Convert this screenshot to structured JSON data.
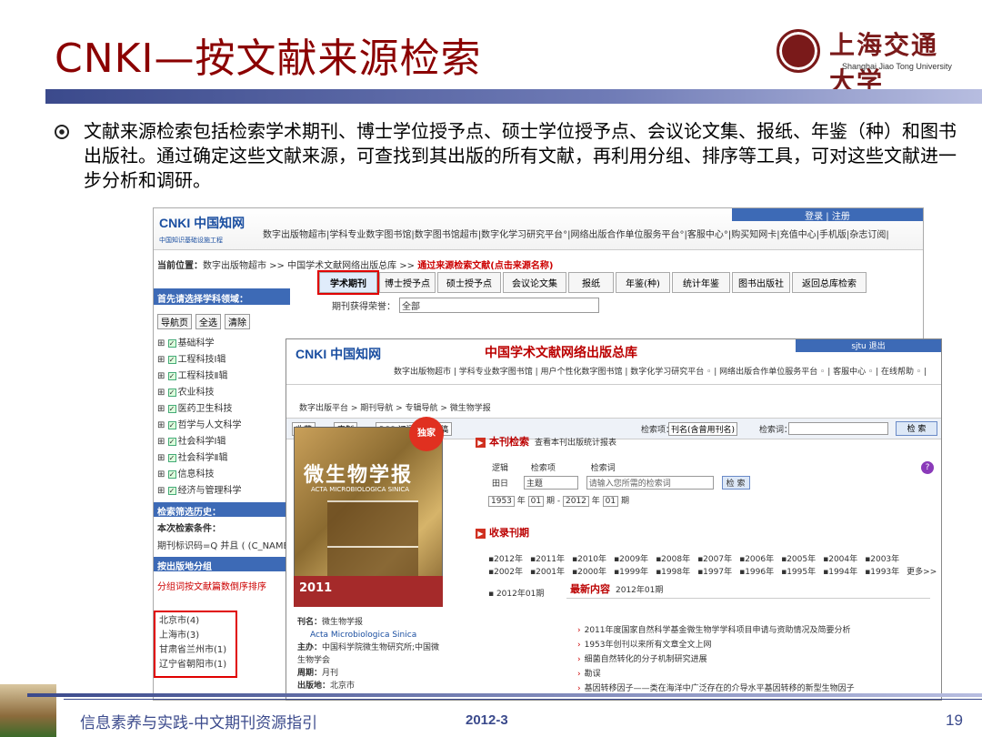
{
  "slide": {
    "title": "CNKI—按文献来源检索",
    "logo_cn": "上海交通大学",
    "logo_en": "Shanghai Jiao Tong University",
    "bullet": "文献来源检索包括检索学术期刊、博士学位授予点、硕士学位授予点、会议论文集、报纸、年鉴（种）和图书出版社。通过确定这些文献来源，可查找到其出版的所有文献，再利用分组、排序等工具，可对这些文献进一步分析和调研。",
    "footer_left": "信息素养与实践-中文期刊资源指引",
    "footer_mid": "2012-3",
    "page_number": "19"
  },
  "back_window": {
    "brand": "CNKI 中国知网",
    "brand_url": "www.cnki.net",
    "brand_sub": "中国知识基础设施工程",
    "login": "登录 | 注册",
    "nav": "数字出版物超市|学科专业数字图书馆|数字图书馆超市|数字化学习研究平台°|网络出版合作单位服务平台°|客服中心°|购买知网卡|充值中心|手机版|杂志订阅|",
    "location_label": "当前位置：",
    "location_path": "数字出版物超市 >> 中国学术文献网络出版总库 >>",
    "location_hint": "通过来源检索文献(点击来源名称)",
    "tabs": [
      "学术期刊",
      "博士授予点",
      "硕士授予点",
      "会议论文集",
      "报纸",
      "年鉴(种)",
      "统计年鉴",
      "图书出版社",
      "返回总库检索"
    ],
    "field_label": "期刊获得荣誉：",
    "field_value": "全部",
    "left_head": "首先请选择学科领域：",
    "left_buttons": [
      "导航页",
      "全选",
      "清除"
    ],
    "subjects": [
      "基础科学",
      "工程科技Ⅰ辑",
      "工程科技Ⅱ辑",
      "农业科技",
      "医药卫生科技",
      "哲学与人文科学",
      "社会科学Ⅰ辑",
      "社会科学Ⅱ辑",
      "信息科技",
      "经济与管理科学"
    ],
    "history_head": "检索筛选历史：",
    "cond_label": "本次检索条件：",
    "cond_value": "期刊标识码=Q 并且 ( (C_NAME=微",
    "group_head": "按出版地分组",
    "sort_link": "分组词按文献篇数倒序排序",
    "regions": [
      "北京市(4)",
      "上海市(3)",
      "甘肃省兰州市(1)",
      "辽宁省朝阳市(1)"
    ]
  },
  "front_window": {
    "brand": "CNKI 中国知网",
    "brand_url": "www.cnki.net",
    "title": "中国学术文献网络出版总库",
    "user": "sjtu 退出",
    "nav": "数字出版物超市 | 学科专业数字图书馆 | 用户个性化数字图书馆 | 数字化学习研究平台 ◦ | 网络出版合作单位服务平台 ◦ | 客服中心 ◦ | 在线帮助 ◦ |",
    "crumb": "数字出版平台 > 期刊导航 > 专辑导航 > 微生物学报",
    "tool_buttons": [
      "收藏",
      "定制",
      "RSS 订阅",
      "投稿"
    ],
    "search_field_label": "检索项：",
    "search_field_value": "刊名(含曾用刊名)",
    "search_word_label": "检索词：",
    "search_button": "检 索",
    "cover_title": "微生物学报",
    "cover_sub": "ACTA MICROBIOLOGICA SINICA",
    "cover_badge": "独家",
    "cover_year": "2011",
    "info": {
      "name_label": "刊名：",
      "name": "微生物学报",
      "name_en": "Acta Microbiologica Sinica",
      "sponsor_label": "主办：",
      "sponsor": "中国科学院微生物研究所;中国微生物学会",
      "period_label": "周期：",
      "period": "月刊",
      "place_label": "出版地：",
      "place": "北京市"
    },
    "section_search": "本刊检索",
    "section_search_sub": "查看本刊出版统计报表",
    "search_logic": "逻辑",
    "search_item": "检索项",
    "search_word": "检索词",
    "search_logic_value": "田日",
    "search_item_value": "主题",
    "search_placeholder": "请输入您所需的检索词",
    "search_btn": "检 索",
    "date_from_year": "1953",
    "date_from_issue": "01",
    "date_to_year": "2012",
    "date_to_issue": "01",
    "year_unit": "年",
    "issue_unit": "期",
    "section_collect": "收录刊期",
    "years_row1": [
      "▪2012年",
      "▪2011年",
      "▪2010年",
      "▪2009年",
      "▪2008年",
      "▪2007年",
      "▪2006年",
      "▪2005年",
      "▪2004年",
      "▪2003年"
    ],
    "years_row2": [
      "▪2002年",
      "▪2001年",
      "▪2000年",
      "▪1999年",
      "▪1998年",
      "▪1997年",
      "▪1996年",
      "▪1995年",
      "▪1994年",
      "▪1993年",
      "更多>>"
    ],
    "issue": "▪ 2012年01期",
    "news_head": "最新内容",
    "news_sub": "2012年01期",
    "news": [
      "2011年度国家自然科学基金微生物学学科项目申请与资助情况及简要分析",
      "1953年创刊以来所有文章全文上网",
      "细菌自然转化的分子机制研究进展",
      "勘误",
      "基因转移因子——类在海洋中广泛存在的介导水平基因转移的新型生物因子"
    ]
  },
  "colors": {
    "title_red": "#8b0000",
    "nav_blue": "#3d6ab6",
    "highlight_red": "#e00000",
    "footer_blue": "#3b4a8c"
  }
}
